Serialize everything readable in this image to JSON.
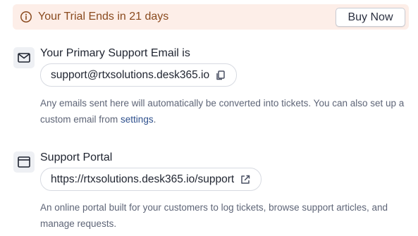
{
  "trial_banner": {
    "text": "Your Trial Ends in 21 days",
    "button_label": "Buy Now",
    "icon": "info-icon",
    "background": "#fdeee8",
    "text_color": "#8a4a1e"
  },
  "email_section": {
    "icon": "mail-icon",
    "title": "Your Primary Support Email is",
    "email": "support@rtxsolutions.desk365.io",
    "action_icon": "copy-icon",
    "description_text": "Any emails sent here will automatically be converted into tickets. You can also set up a custom email from",
    "link_text": "settings",
    "description_suffix": "."
  },
  "portal_section": {
    "icon": "browser-window-icon",
    "title": "Support Portal",
    "url": "https://rtxsolutions.desk365.io/support",
    "action_icon": "external-link-icon",
    "description": "An online portal built for your customers to log tickets, browse support articles, and manage requests."
  }
}
